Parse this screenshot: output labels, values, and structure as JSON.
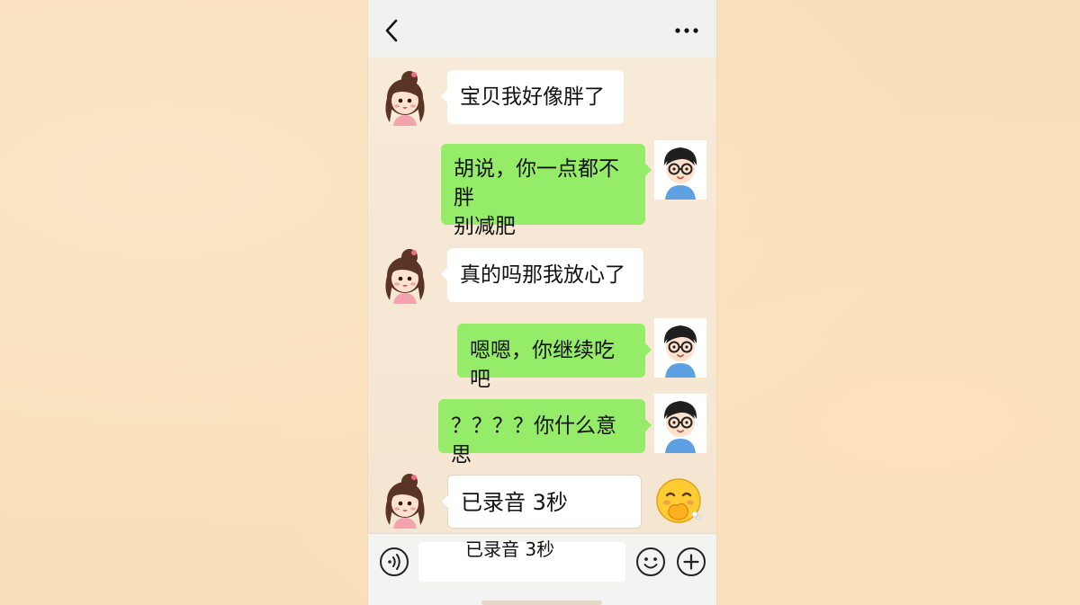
{
  "header": {
    "back_icon": "chevron-left-icon",
    "more_icon": "more-dots-icon"
  },
  "messages": [
    {
      "sender": "girl",
      "text": "宝贝我好像胖了"
    },
    {
      "sender": "boy",
      "line1": "胡说，你一点都不胖",
      "line2": "别减肥"
    },
    {
      "sender": "girl",
      "text": "真的吗那我放心了"
    },
    {
      "sender": "boy",
      "text": "嗯嗯，你继续吃吧"
    },
    {
      "sender": "boy",
      "text": "？？？？你什么意思"
    },
    {
      "sender": "girl",
      "text": "已录音 3秒",
      "emoji": "laugh-covering-mouth-emoji"
    }
  ],
  "input_bar": {
    "voice_icon": "voice-icon",
    "input_overlay_text": "已录音 3秒",
    "emoji_icon": "smiley-icon",
    "add_icon": "plus-circle-icon"
  },
  "colors": {
    "background": "#f8dfba",
    "bubble_green": "#95ec69",
    "bubble_white": "#ffffff"
  }
}
